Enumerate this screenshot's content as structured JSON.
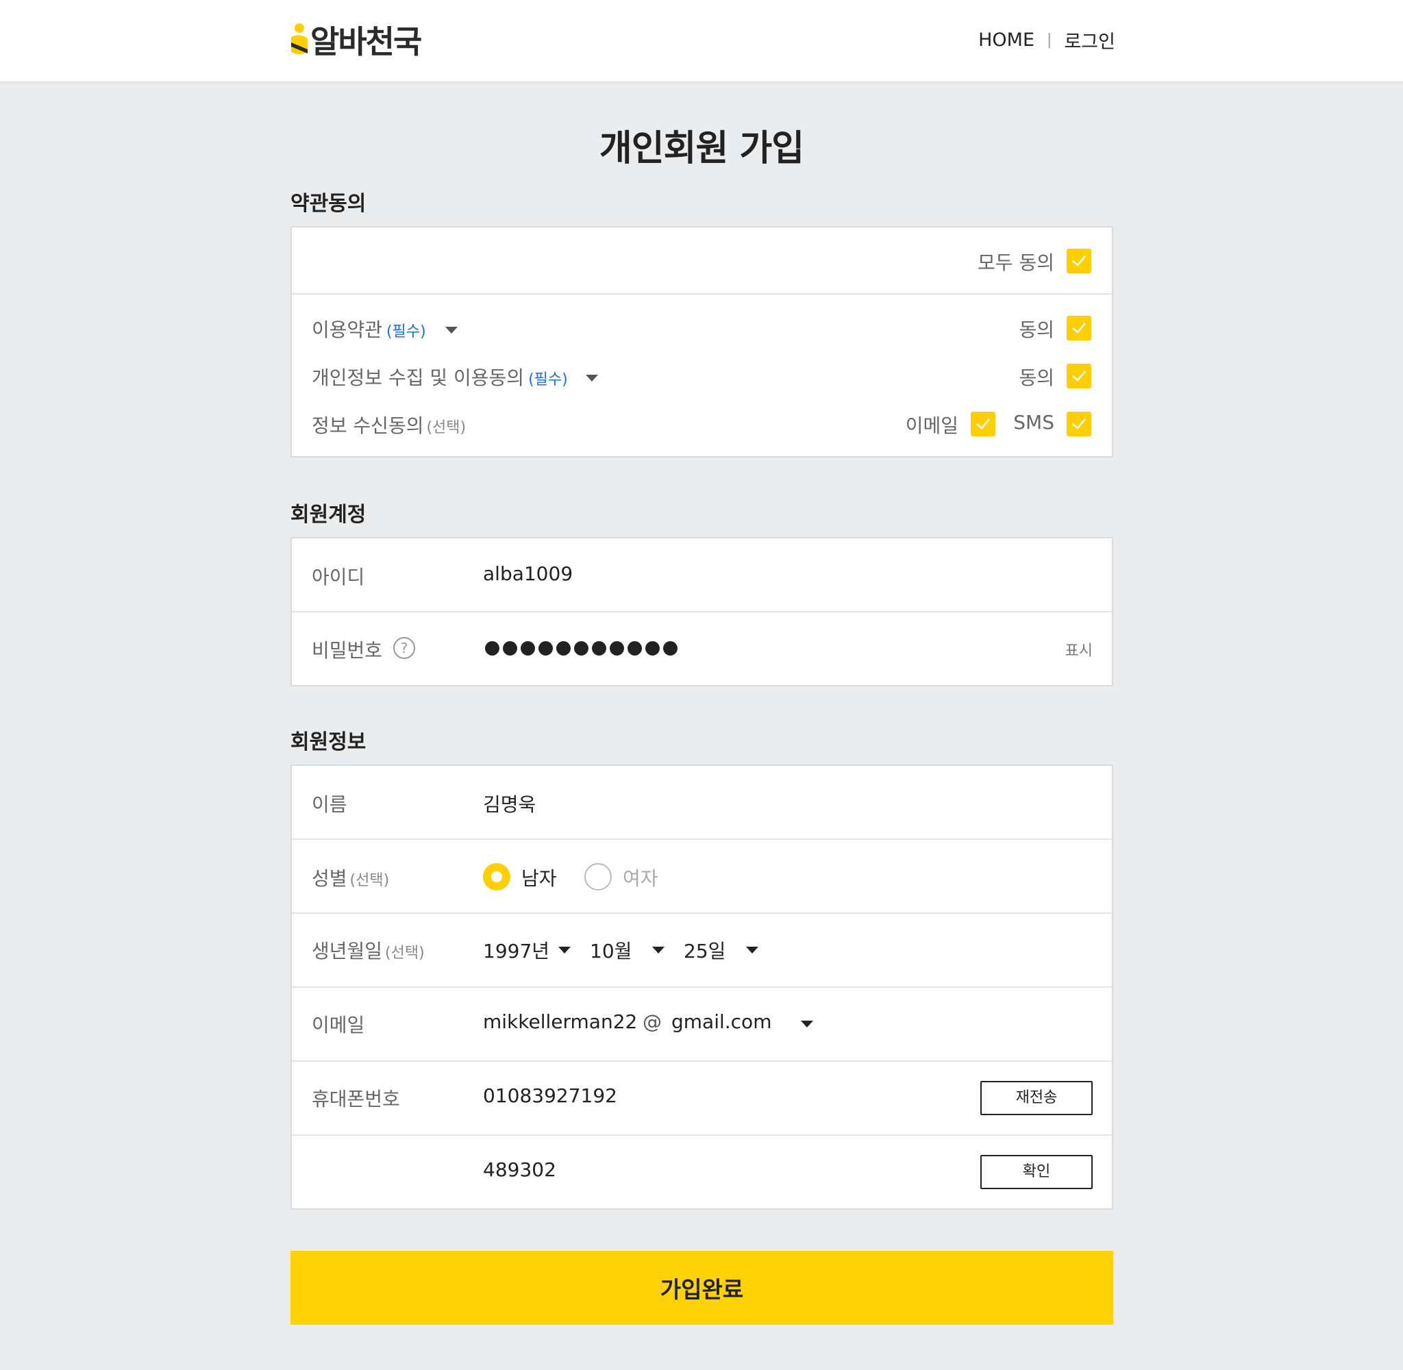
{
  "header": {
    "logo_text": "알바천국",
    "nav_home": "HOME",
    "nav_separator": "|",
    "nav_login": "로그인"
  },
  "page": {
    "title": "개인회원 가입"
  },
  "terms": {
    "section_title": "약관동의",
    "agree_all_label": "모두 동의",
    "agree_all_checked": true,
    "items": [
      {
        "label": "이용약관",
        "tag": "(필수)",
        "agree_label": "동의",
        "checked": true
      },
      {
        "label": "개인정보 수집 및 이용동의",
        "tag": "(필수)",
        "agree_label": "동의",
        "checked": true
      }
    ],
    "marketing": {
      "label": "정보 수신동의",
      "tag": "(선택)",
      "email_label": "이메일",
      "email_checked": true,
      "sms_label": "SMS",
      "sms_checked": true
    }
  },
  "account": {
    "section_title": "회원계정",
    "id_label": "아이디",
    "id_value": "alba1009",
    "password_label": "비밀번호",
    "password_help_icon": "?",
    "password_mask_count": 11,
    "password_show_label": "표시"
  },
  "member": {
    "section_title": "회원정보",
    "name_label": "이름",
    "name_value": "김명욱",
    "gender_label": "성별",
    "gender_tag": "(선택)",
    "gender_male": "남자",
    "gender_female": "여자",
    "gender_selected": "남자",
    "birth_label": "생년월일",
    "birth_tag": "(선택)",
    "birth_year": "1997년",
    "birth_month": "10월",
    "birth_day": "25일",
    "email_label": "이메일",
    "email_local": "mikkellerman22",
    "email_at": "@",
    "email_domain": "gmail.com",
    "phone_label": "휴대폰번호",
    "phone_value": "01083927192",
    "resend_label": "재전송",
    "code_value": "489302",
    "confirm_label": "확인"
  },
  "submit_label": "가입완료",
  "colors": {
    "accent": "#ffcf06",
    "required": "#1e6fd9",
    "background": "#ebecee"
  }
}
